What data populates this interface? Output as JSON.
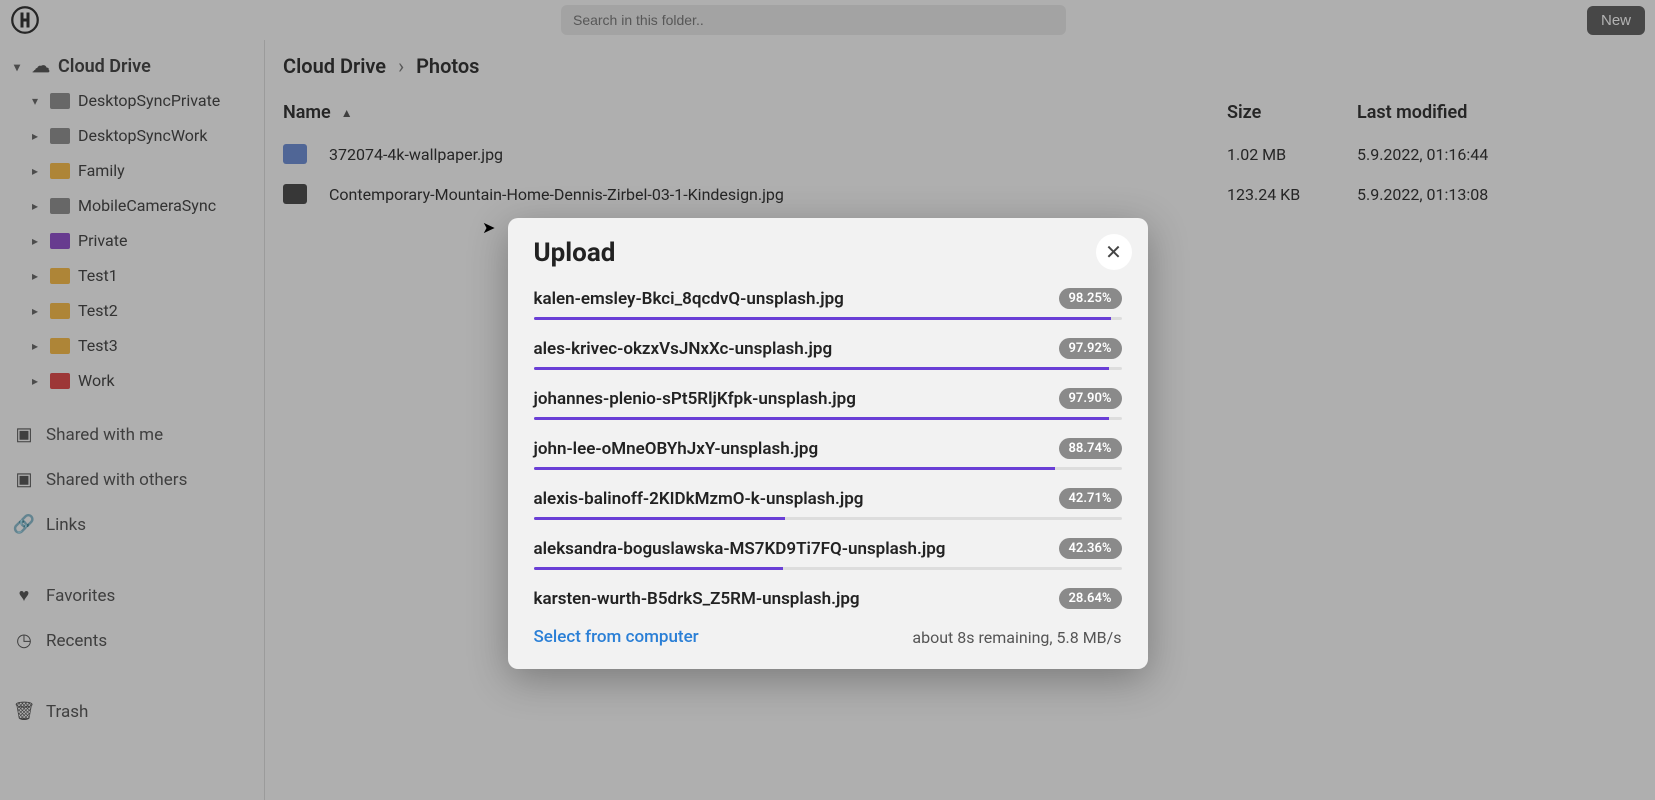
{
  "header": {
    "search_placeholder": "Search in this folder..",
    "new_button_label": "New"
  },
  "sidebar": {
    "root_label": "Cloud Drive",
    "folders": [
      {
        "label": "DesktopSyncPrivate",
        "color": "gray",
        "caret": "down"
      },
      {
        "label": "DesktopSyncWork",
        "color": "gray",
        "caret": "right"
      },
      {
        "label": "Family",
        "color": "yellow",
        "caret": "right"
      },
      {
        "label": "MobileCameraSync",
        "color": "gray",
        "caret": "right"
      },
      {
        "label": "Private",
        "color": "purple",
        "caret": "right"
      },
      {
        "label": "Test1",
        "color": "yellow",
        "caret": "right"
      },
      {
        "label": "Test2",
        "color": "yellow",
        "caret": "right"
      },
      {
        "label": "Test3",
        "color": "yellow",
        "caret": "right"
      },
      {
        "label": "Work",
        "color": "red",
        "caret": "right"
      }
    ],
    "links": [
      {
        "label": "Shared with me",
        "icon": "share-in"
      },
      {
        "label": "Shared with others",
        "icon": "share-out"
      },
      {
        "label": "Links",
        "icon": "link"
      },
      {
        "label": "Favorites",
        "icon": "heart"
      },
      {
        "label": "Recents",
        "icon": "clock"
      },
      {
        "label": "Trash",
        "icon": "trash"
      }
    ]
  },
  "breadcrumb": {
    "parent": "Cloud Drive",
    "current": "Photos"
  },
  "columns": {
    "name": "Name",
    "size": "Size",
    "modified": "Last modified",
    "sort_dir": "asc"
  },
  "files": [
    {
      "name": "372074-4k-wallpaper.jpg",
      "size": "1.02 MB",
      "modified": "5.9.2022, 01:16:44"
    },
    {
      "name": "Contemporary-Mountain-Home-Dennis-Zirbel-03-1-Kindesign.jpg",
      "size": "123.24 KB",
      "modified": "5.9.2022, 01:13:08"
    }
  ],
  "modal": {
    "title": "Upload",
    "select_label": "Select from computer",
    "status": "about 8s remaining, 5.8 MB/s",
    "uploads": [
      {
        "name": "kalen-emsley-Bkci_8qcdvQ-unsplash.jpg",
        "percent": 98.25
      },
      {
        "name": "ales-krivec-okzxVsJNxXc-unsplash.jpg",
        "percent": 97.92
      },
      {
        "name": "johannes-plenio-sPt5RljKfpk-unsplash.jpg",
        "percent": 97.9
      },
      {
        "name": "john-lee-oMneOBYhJxY-unsplash.jpg",
        "percent": 88.74
      },
      {
        "name": "alexis-balinoff-2KIDkMzmO-k-unsplash.jpg",
        "percent": 42.71
      },
      {
        "name": "aleksandra-boguslawska-MS7KD9Ti7FQ-unsplash.jpg",
        "percent": 42.36
      },
      {
        "name": "karsten-wurth-B5drkS_Z5RM-unsplash.jpg",
        "percent": 28.64
      }
    ]
  }
}
